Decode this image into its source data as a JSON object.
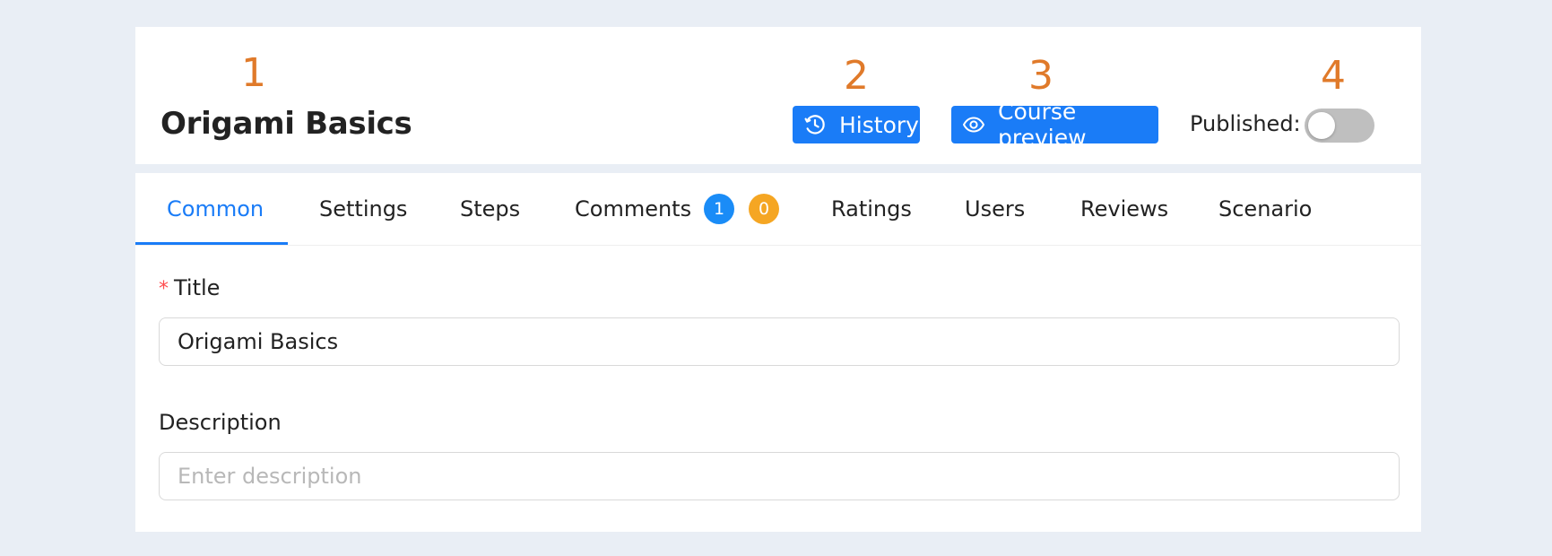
{
  "annotations": {
    "marker_1": "1",
    "marker_2": "2",
    "marker_3": "3",
    "marker_4": "4"
  },
  "header": {
    "title": "Origami Basics",
    "history_label": "History",
    "history_icon": "history-clock-icon",
    "preview_label": "Course preview",
    "preview_icon": "eye-icon",
    "published_label": "Published:",
    "published": false
  },
  "tabs": [
    {
      "label": "Common",
      "active": true
    },
    {
      "label": "Settings",
      "active": false
    },
    {
      "label": "Steps",
      "active": false
    },
    {
      "label": "Comments",
      "active": false,
      "badges": [
        "1",
        "0"
      ]
    },
    {
      "label": "Ratings",
      "active": false
    },
    {
      "label": "Users",
      "active": false
    },
    {
      "label": "Reviews",
      "active": false
    },
    {
      "label": "Scenario",
      "active": false
    }
  ],
  "form": {
    "title_label": "Title",
    "title_value": "Origami Basics",
    "description_label": "Description",
    "description_placeholder": "Enter description",
    "description_value": ""
  },
  "colors": {
    "primary": "#1a7cf7",
    "marker": "#e07a2a",
    "badge_blue": "#1a8cf7",
    "badge_orange": "#f5a623",
    "required": "#ff4d4f",
    "toggle_off": "#bfbfbf",
    "page_bg": "#e9eef5"
  }
}
